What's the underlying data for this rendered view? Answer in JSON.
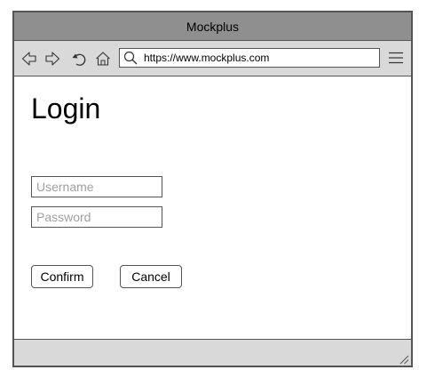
{
  "window": {
    "title": "Mockplus"
  },
  "toolbar": {
    "icons": [
      "back-icon",
      "forward-icon",
      "refresh-icon",
      "home-icon",
      "search-icon",
      "menu-icon"
    ],
    "url": "https://www.mockplus.com"
  },
  "page": {
    "title": "Login",
    "username_placeholder": "Username",
    "password_placeholder": "Password",
    "confirm_label": "Confirm",
    "cancel_label": "Cancel"
  },
  "colors": {
    "titlebar": "#8f8f8f",
    "toolbar": "#d9d9d9",
    "border": "#555555",
    "placeholder": "#a0a0a0"
  }
}
